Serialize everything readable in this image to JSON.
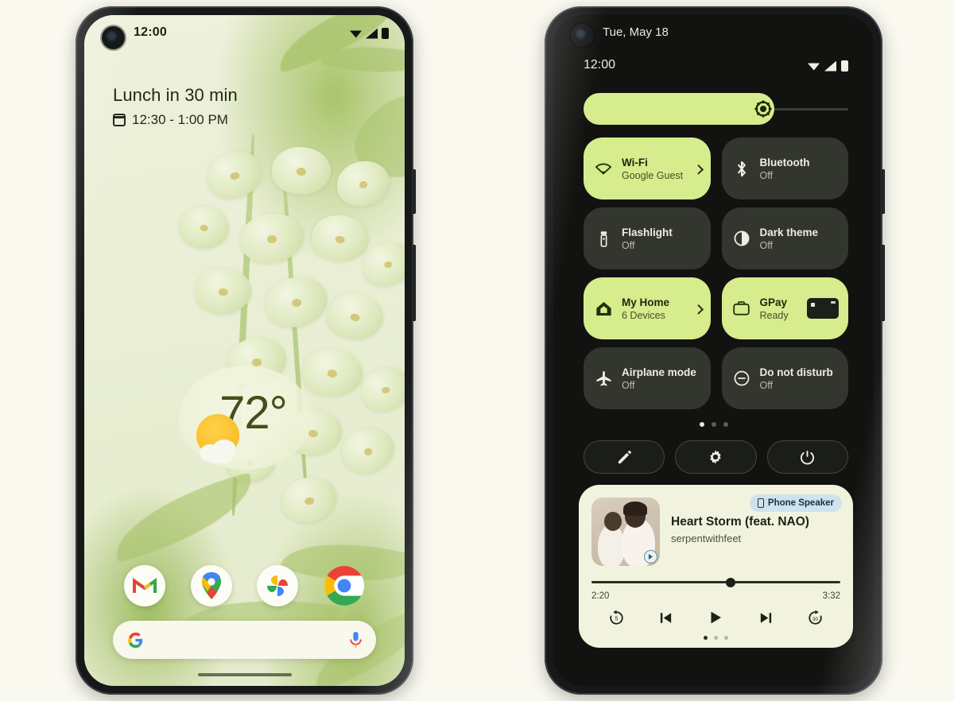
{
  "left_phone": {
    "status_bar": {
      "time": "12:00",
      "icons": [
        "wifi-icon",
        "cellular-signal-icon",
        "battery-icon"
      ]
    },
    "at_a_glance": {
      "title": "Lunch in 30 min",
      "calendar_icon": "calendar-icon",
      "time_range": "12:30 - 1:00 PM"
    },
    "weather_widget": {
      "temperature": "72°",
      "condition_icon": "partly-sunny-icon"
    },
    "dock": {
      "apps": [
        {
          "name": "Gmail",
          "icon": "gmail-icon"
        },
        {
          "name": "Maps",
          "icon": "google-maps-icon"
        },
        {
          "name": "Photos",
          "icon": "google-photos-icon"
        },
        {
          "name": "Chrome",
          "icon": "chrome-icon"
        }
      ]
    },
    "search_bar": {
      "logo_icon": "google-g-icon",
      "mic_icon": "microphone-icon",
      "placeholder": ""
    }
  },
  "right_phone": {
    "status_bar": {
      "date": "Tue, May 18",
      "time": "12:00",
      "icons": [
        "wifi-icon",
        "cellular-signal-icon",
        "battery-icon"
      ]
    },
    "brightness": {
      "icon": "brightness-icon",
      "level_percent": 72
    },
    "tiles": [
      {
        "label": "Wi-Fi",
        "sub": "Google Guest",
        "icon": "wifi-icon",
        "on": true,
        "chevron": true
      },
      {
        "label": "Bluetooth",
        "sub": "Off",
        "icon": "bluetooth-icon",
        "on": false,
        "chevron": false
      },
      {
        "label": "Flashlight",
        "sub": "Off",
        "icon": "flashlight-icon",
        "on": false,
        "chevron": false
      },
      {
        "label": "Dark theme",
        "sub": "Off",
        "icon": "dark-theme-icon",
        "on": false,
        "chevron": false
      },
      {
        "label": "My Home",
        "sub": "6 Devices",
        "icon": "home-icon",
        "on": true,
        "chevron": true
      },
      {
        "label": "GPay",
        "sub": "Ready",
        "icon": "wallet-icon",
        "on": true,
        "chevron": false
      },
      {
        "label": "Airplane mode",
        "sub": "Off",
        "icon": "airplane-icon",
        "on": false,
        "chevron": false
      },
      {
        "label": "Do not disturb",
        "sub": "Off",
        "icon": "do-not-disturb-icon",
        "on": false,
        "chevron": false
      }
    ],
    "page_dots": {
      "count": 3,
      "active_index": 0
    },
    "actions": [
      {
        "name": "edit-tiles-button",
        "icon": "pencil-icon"
      },
      {
        "name": "settings-button",
        "icon": "gear-icon"
      },
      {
        "name": "power-button",
        "icon": "power-icon"
      }
    ],
    "media_player": {
      "output_chip": {
        "label": "Phone Speaker",
        "icon": "phone-icon"
      },
      "title": "Heart Storm (feat. NAO)",
      "artist": "serpentwithfeet",
      "album_art_badge_icon": "play-circle-icon",
      "elapsed": "2:20",
      "duration": "3:32",
      "progress_percent": 56,
      "controls": [
        {
          "name": "rewind-5-button",
          "icon": "replay-5-icon"
        },
        {
          "name": "previous-button",
          "icon": "skip-previous-icon"
        },
        {
          "name": "play-button",
          "icon": "play-icon"
        },
        {
          "name": "next-button",
          "icon": "skip-next-icon"
        },
        {
          "name": "forward-30-button",
          "icon": "forward-30-icon"
        }
      ],
      "page_dots": {
        "count": 3,
        "active_index": 0
      }
    }
  },
  "colors": {
    "background": "#faf9f0",
    "accent_lime": "#d7ec8c",
    "tile_dark": "#33352f",
    "panel_dark": "#121310",
    "media_card": "#f2f3de",
    "chip_blue": "#cfe3ef"
  }
}
